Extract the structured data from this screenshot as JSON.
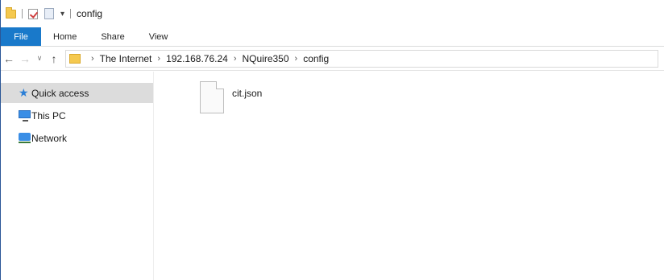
{
  "window": {
    "title": "config"
  },
  "ribbon": {
    "tabs": [
      {
        "label": "File"
      },
      {
        "label": "Home"
      },
      {
        "label": "Share"
      },
      {
        "label": "View"
      }
    ]
  },
  "navigation": {
    "back_icon": "back-arrow-icon",
    "forward_icon": "forward-arrow-icon",
    "recent_icon": "chevron-down-icon",
    "up_icon": "up-arrow-icon",
    "breadcrumb": [
      "The Internet",
      "192.168.76.24",
      "NQuire350",
      "config"
    ]
  },
  "sidebar": {
    "items": [
      {
        "label": "Quick access",
        "icon": "star-icon",
        "selected": true
      },
      {
        "label": "This PC",
        "icon": "computer-icon",
        "selected": false
      },
      {
        "label": "Network",
        "icon": "network-icon",
        "selected": false
      }
    ]
  },
  "files": [
    {
      "name": "cit.json",
      "icon": "file-icon"
    }
  ],
  "colors": {
    "file_tab": "#1979ca",
    "selected_item": "#dcdcdc",
    "folder": "#f5c94f"
  }
}
